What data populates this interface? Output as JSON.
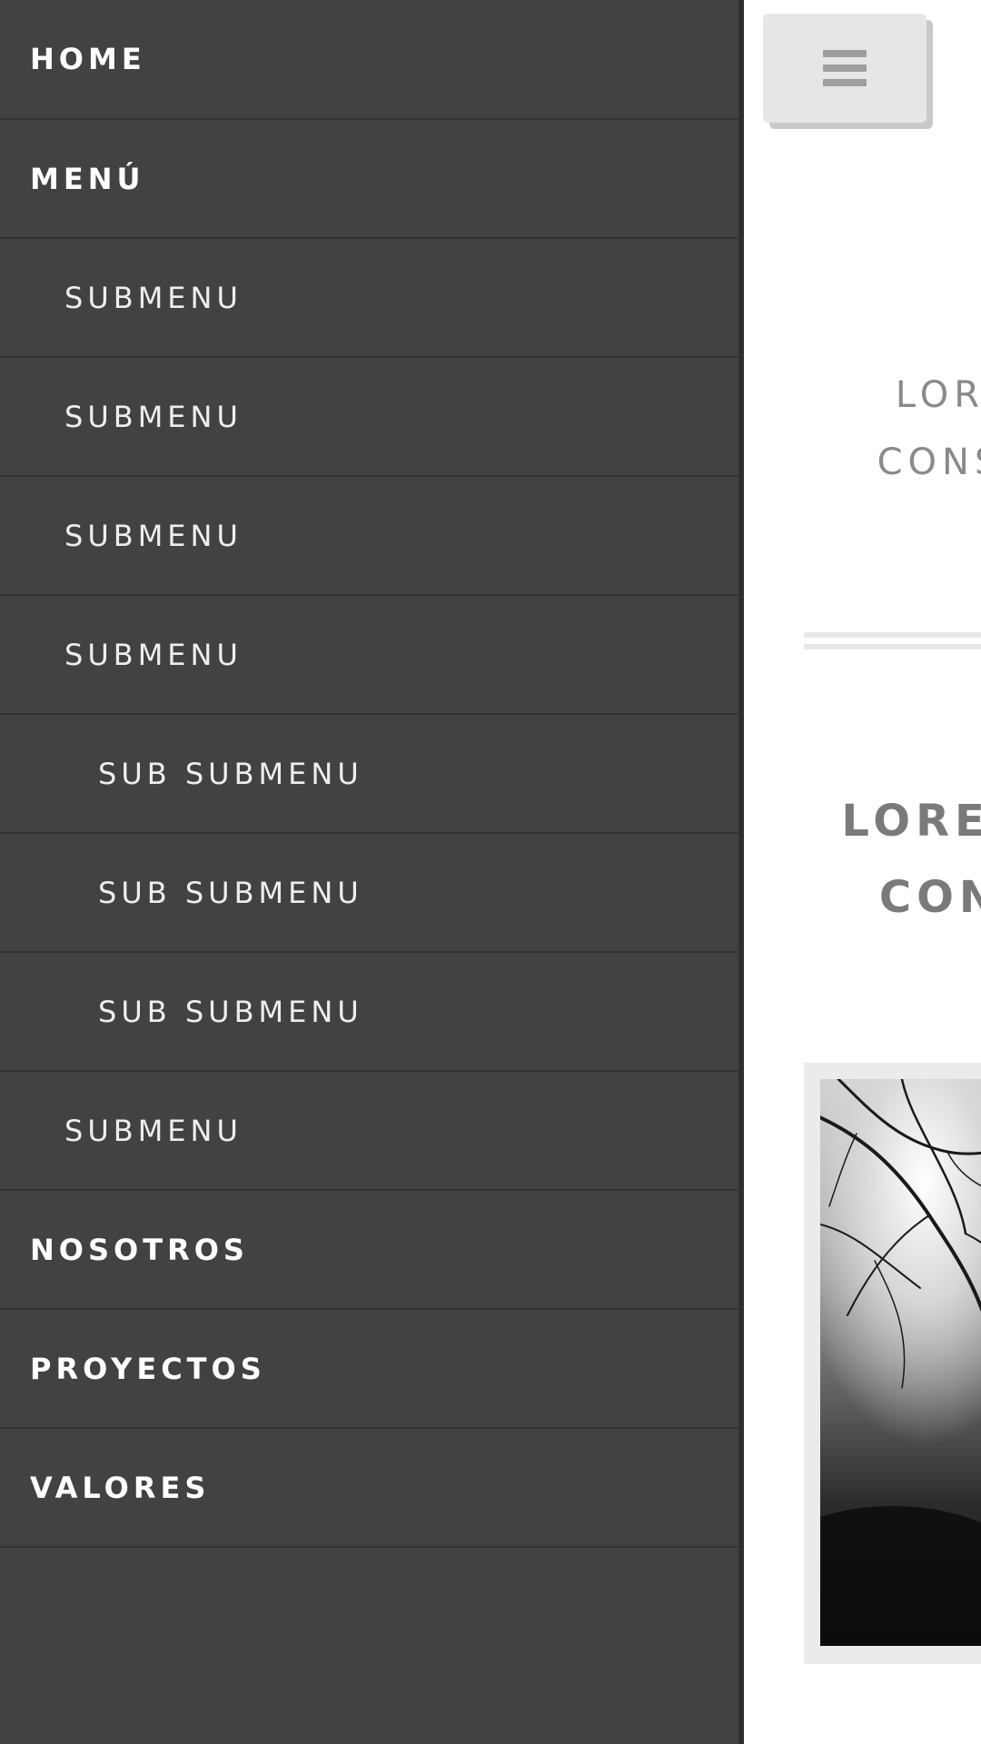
{
  "nav": {
    "items": [
      {
        "label": "HOME",
        "level": 1
      },
      {
        "label": "MENÚ",
        "level": 1
      },
      {
        "label": "SUBMENU",
        "level": 2
      },
      {
        "label": "SUBMENU",
        "level": 2
      },
      {
        "label": "SUBMENU",
        "level": 2
      },
      {
        "label": "SUBMENU",
        "level": 2
      },
      {
        "label": "SUB SUBMENU",
        "level": 3
      },
      {
        "label": "SUB SUBMENU",
        "level": 3
      },
      {
        "label": "SUB SUBMENU",
        "level": 3
      },
      {
        "label": "SUBMENU",
        "level": 2
      },
      {
        "label": "NOSOTROS",
        "level": 1
      },
      {
        "label": "PROYECTOS",
        "level": 1
      },
      {
        "label": "VALORES",
        "level": 1
      }
    ]
  },
  "main": {
    "menu_toggle_icon": "hamburger-icon",
    "intro_line_1": "LOR",
    "intro_line_2": "CONS",
    "headline_line_1": "LOREM",
    "headline_line_2": "CON"
  },
  "colors": {
    "sidenav_bg": "#424242",
    "sidenav_text": "#ffffff",
    "toggle_bg": "#e6e6e6",
    "content_text": "#8a8a8a"
  }
}
